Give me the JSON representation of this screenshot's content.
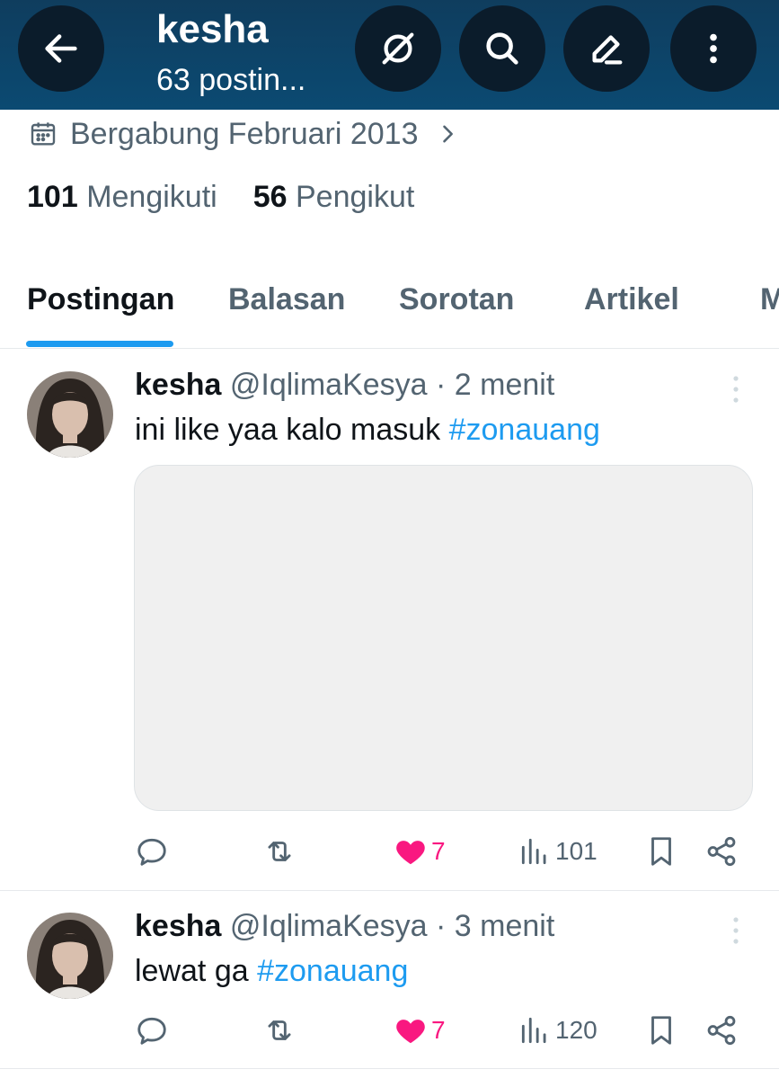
{
  "header": {
    "name": "kesha",
    "post_count": "63 postin...",
    "icons": [
      "back-arrow-icon",
      "grok-icon",
      "search-icon",
      "edit-icon",
      "more-vertical-icon"
    ]
  },
  "profile": {
    "joined": "Bergabung Februari 2013",
    "following_count": "101",
    "following_label": "Mengikuti",
    "followers_count": "56",
    "followers_label": "Pengikut"
  },
  "tabs": [
    {
      "label": "Postingan",
      "active": true
    },
    {
      "label": "Balasan"
    },
    {
      "label": "Sorotan"
    },
    {
      "label": "Artikel"
    },
    {
      "label": "M"
    }
  ],
  "posts": [
    {
      "name": "kesha",
      "meta": "@IqlimaKesya · 2 menit",
      "text": "ini like yaa kalo masuk ",
      "hashtag": "#zonauang",
      "likes": "7",
      "views": "101"
    },
    {
      "name": "kesha",
      "meta": "@IqlimaKesya · 3 menit",
      "text": "lewat ga ",
      "hashtag": "#zonauang",
      "likes": "7",
      "views": "120"
    }
  ],
  "colors": {
    "header_bg": "#0b4a72",
    "accent": "#1d9bf0",
    "like": "#f91880",
    "muted": "#536471"
  }
}
